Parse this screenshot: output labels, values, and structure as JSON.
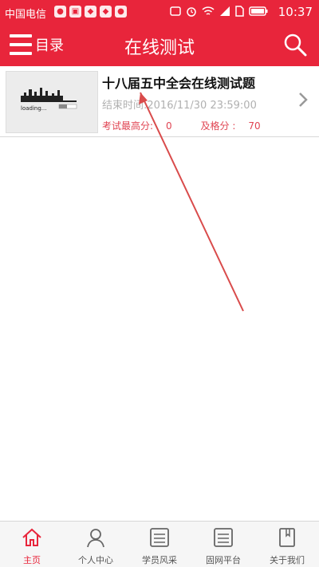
{
  "status_bar": {
    "carrier": "中国电信",
    "time": "10:37",
    "left_icons": [
      "wechat-icon",
      "gallery-icon",
      "app-icon",
      "app-icon",
      "chat-icon"
    ],
    "right_icons": [
      "nfc-icon",
      "alarm-icon",
      "wifi-icon",
      "signal-icon",
      "sim-icon",
      "battery-icon"
    ]
  },
  "header": {
    "menu_label": "目录",
    "title": "在线测试",
    "menu_icon": "hamburger-icon",
    "search_icon": "search-icon"
  },
  "tests": [
    {
      "title": "十八届五中全会在线测试题",
      "end_time_label": "结束时间:",
      "end_time": "2016/11/30 23:59:00",
      "max_score_label": "考试最高分:",
      "max_score": "0",
      "pass_score_label": "及格分 :",
      "pass_score": "70",
      "thumbnail_text": "loading..."
    }
  ],
  "bottom_nav": [
    {
      "label": "主页",
      "icon": "home-icon",
      "active": true
    },
    {
      "label": "个人中心",
      "icon": "person-icon",
      "active": false
    },
    {
      "label": "学员风采",
      "icon": "list-icon",
      "active": false
    },
    {
      "label": "固网平台",
      "icon": "list-icon",
      "active": false
    },
    {
      "label": "关于我们",
      "icon": "book-icon",
      "active": false
    }
  ],
  "colors": {
    "brand_red": "#e8253b",
    "score_red": "#e04452",
    "muted_gray": "#b0b0b0",
    "annotation_arrow": "#d94b4b"
  }
}
